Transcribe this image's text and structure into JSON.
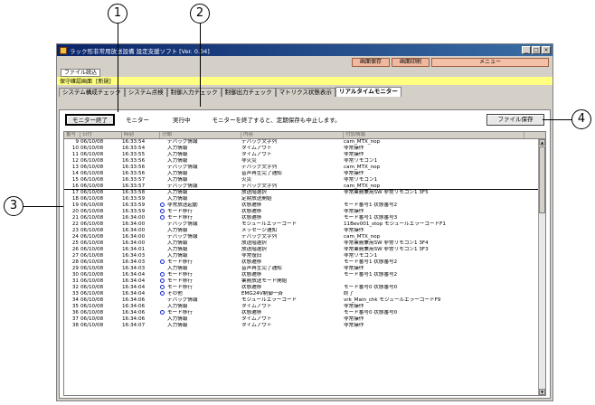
{
  "callouts": [
    "1",
    "2",
    "3",
    "4"
  ],
  "window": {
    "title": "ラック形非常用放送設備 設定支援ソフト [Ver. 0.04]",
    "controls": [
      "_",
      "□",
      "×"
    ]
  },
  "toolbar": {
    "screen_save": "画面保存",
    "screen_print": "画面印刷",
    "menu": "メニュー"
  },
  "file_menu": "ファイル読込",
  "status": {
    "screen": "保守確認画面",
    "mode": "[新規]"
  },
  "tabs": [
    "システム構成チェック",
    "システム点検",
    "制御入力チェック",
    "制御出力チェック",
    "マトリクス状態表示",
    "リアルタイムモニター"
  ],
  "controls": {
    "stop_button": "モニター終了",
    "monitor_label": "モニター",
    "state": "実行中",
    "message": "モニターを終了すると、定期保存も中止します。",
    "file_save": "ファイル保存"
  },
  "grid": {
    "headers": [
      "番号",
      "日付",
      "時刻",
      "分類",
      "内容",
      "付加情報"
    ],
    "rows": [
      {
        "no": "9",
        "date": "06/10/08",
        "time": "16:33:54",
        "mark": "",
        "cat": "デバッグ情報",
        "cont": "デバッグ文字列",
        "add": "cam_MTX_nop"
      },
      {
        "no": "10",
        "date": "06/10/08",
        "time": "16:33:54",
        "mark": "",
        "cat": "入力情報",
        "cont": "タイムアウト",
        "add": "非常操作"
      },
      {
        "no": "11",
        "date": "06/10/08",
        "time": "16:33:55",
        "mark": "",
        "cat": "入力情報",
        "cont": "タイムアウト",
        "add": "非常操作"
      },
      {
        "no": "12",
        "date": "06/10/08",
        "time": "16:33:56",
        "mark": "",
        "cat": "入力情報",
        "cont": "非火災",
        "add": "非常リモコン1"
      },
      {
        "no": "13",
        "date": "06/10/08",
        "time": "16:33:56",
        "mark": "",
        "cat": "デバッグ情報",
        "cont": "デバッグ文字列",
        "add": "cam_MTX_nop"
      },
      {
        "no": "14",
        "date": "06/10/08",
        "time": "16:33:56",
        "mark": "",
        "cat": "入力情報",
        "cont": "音声再生完了通知",
        "add": "非常操作"
      },
      {
        "no": "15",
        "date": "06/10/08",
        "time": "16:33:57",
        "mark": "",
        "cat": "入力情報",
        "cont": "火災",
        "add": "非常リモコン1"
      },
      {
        "no": "16",
        "date": "06/10/08",
        "time": "16:33:57",
        "mark": "",
        "cat": "デバッグ情報",
        "cont": "デバッグ文字列",
        "add": "cam_MTX_nop"
      },
      {
        "no": "17",
        "date": "06/10/08",
        "time": "16:33:58",
        "mark": "",
        "cat": "入力情報",
        "cont": "放送階選択",
        "add": "非常業務兼用SW 非常リモコン1 3F5"
      },
      {
        "no": "18",
        "date": "06/10/08",
        "time": "16:33:59",
        "mark": "",
        "cat": "入力情報",
        "cont": "定期放送開始",
        "add": ""
      },
      {
        "no": "19",
        "date": "06/10/08",
        "time": "16:33:59",
        "mark": "o",
        "cat": "非常放送起動",
        "cont": "状態遷移",
        "add": "モード番号1 状態番号2"
      },
      {
        "no": "20",
        "date": "06/10/08",
        "time": "16:33:59",
        "mark": "o",
        "cat": "モード移行",
        "cont": "状態遷移",
        "add": "非常操作"
      },
      {
        "no": "21",
        "date": "06/10/08",
        "time": "16:34:00",
        "mark": "o",
        "cat": "モード移行",
        "cont": "状態遷移",
        "add": "モード番号1 状態番号3"
      },
      {
        "no": "22",
        "date": "06/10/08",
        "time": "16:34:00",
        "mark": "",
        "cat": "デバッグ情報",
        "cont": "モジュールエラーコード",
        "add": "11Bev001_stop モジュールエラーコードF1"
      },
      {
        "no": "23",
        "date": "06/10/08",
        "time": "16:34:00",
        "mark": "",
        "cat": "入力情報",
        "cont": "メッセージ通知",
        "add": "非常操作"
      },
      {
        "no": "24",
        "date": "06/10/08",
        "time": "16:34:00",
        "mark": "",
        "cat": "デバッグ情報",
        "cont": "デバッグ文字列",
        "add": "cam_MTX_nop"
      },
      {
        "no": "25",
        "date": "06/10/08",
        "time": "16:34:00",
        "mark": "",
        "cat": "入力情報",
        "cont": "放送階選択",
        "add": "非常業務兼用SW 非常リモコン1 3F4"
      },
      {
        "no": "26",
        "date": "06/10/08",
        "time": "16:34:01",
        "mark": "",
        "cat": "入力情報",
        "cont": "放送階選択",
        "add": "非常業務兼用SW 非常リモコン1 3F3"
      },
      {
        "no": "27",
        "date": "06/10/08",
        "time": "16:34:03",
        "mark": "",
        "cat": "入力情報",
        "cont": "非常復旧",
        "add": "非常リモコン1"
      },
      {
        "no": "28",
        "date": "06/10/08",
        "time": "16:34:03",
        "mark": "o",
        "cat": "モード移行",
        "cont": "状態遷移",
        "add": "モード番号1 状態番号2"
      },
      {
        "no": "29",
        "date": "06/10/08",
        "time": "16:34:03",
        "mark": "",
        "cat": "入力情報",
        "cont": "音声再生完了通知",
        "add": "非常操作"
      },
      {
        "no": "30",
        "date": "06/10/08",
        "time": "16:34:04",
        "mark": "o",
        "cat": "モード移行",
        "cont": "状態遷移",
        "add": "モード番号1 状態番号2"
      },
      {
        "no": "31",
        "date": "06/10/08",
        "time": "16:34:04",
        "mark": "o",
        "cat": "モード移行",
        "cont": "業務放送モード開始",
        "add": ""
      },
      {
        "no": "32",
        "date": "06/10/08",
        "time": "16:34:04",
        "mark": "o",
        "cat": "モード移行",
        "cont": "状態遷移",
        "add": "モード番号0 状態番号0"
      },
      {
        "no": "33",
        "date": "06/10/08",
        "time": "16:34:04",
        "mark": "o",
        "cat": "その他",
        "cont": "EMG24V制御一斉",
        "add": "終了"
      },
      {
        "no": "34",
        "date": "06/10/08",
        "time": "16:34:06",
        "mark": "",
        "cat": "デバッグ情報",
        "cont": "モジュールエラーコード",
        "add": "vrk_Main_chk モジュールエラーコードF9"
      },
      {
        "no": "35",
        "date": "06/10/08",
        "time": "16:34:06",
        "mark": "",
        "cat": "入力情報",
        "cont": "タイムアウト",
        "add": "非常操作"
      },
      {
        "no": "36",
        "date": "06/10/08",
        "time": "16:34:06",
        "mark": "o",
        "cat": "モード移行",
        "cont": "状態遷移",
        "add": "モード番号0 状態番号0"
      },
      {
        "no": "37",
        "date": "06/10/08",
        "time": "16:34:06",
        "mark": "",
        "cat": "入力情報",
        "cont": "タイムアウト",
        "add": "非常操作"
      },
      {
        "no": "38",
        "date": "06/10/08",
        "time": "16:34:07",
        "mark": "",
        "cat": "入力情報",
        "cont": "タイムアウト",
        "add": "非常操作"
      }
    ]
  },
  "colors": {
    "title_bar": "#0a246a",
    "status_bar": "#ffff80",
    "marker": "#1a2ad0",
    "menu_button": "#f4c0a8"
  }
}
